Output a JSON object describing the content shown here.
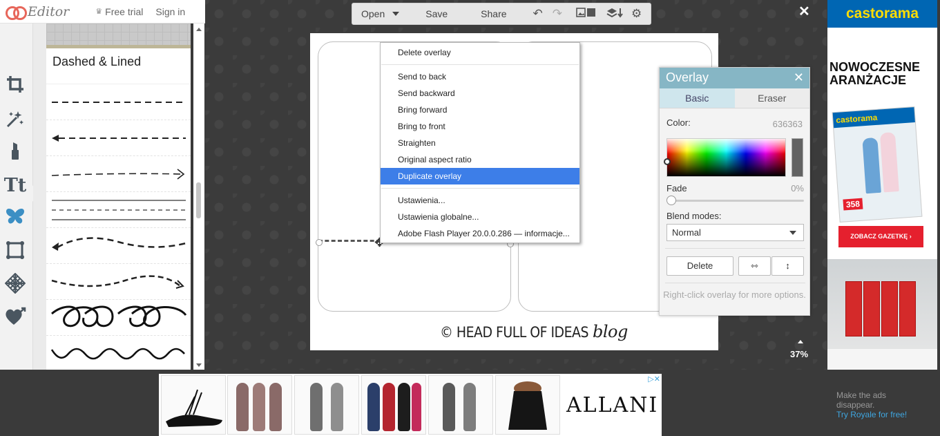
{
  "header": {
    "app_name": "Editor",
    "free_trial": "Free trial",
    "sign_in": "Sign in"
  },
  "tools": [
    {
      "name": "crop-icon",
      "glyph": "⌗"
    },
    {
      "name": "effects-wand-icon",
      "glyph": "✶"
    },
    {
      "name": "touch-up-lipstick-icon",
      "glyph": "▮"
    },
    {
      "name": "text-icon",
      "glyph": "Tt"
    },
    {
      "name": "overlays-butterfly-icon",
      "glyph": "❦"
    },
    {
      "name": "frames-icon",
      "glyph": "▣"
    },
    {
      "name": "textures-icon",
      "glyph": "▦"
    },
    {
      "name": "themes-heart-icon",
      "glyph": "♥"
    }
  ],
  "panel": {
    "section_title": "Dashed & Lined"
  },
  "menubar": {
    "open": "Open",
    "save": "Save",
    "share": "Share"
  },
  "canvas": {
    "watermark_text": "© HEAD FULL OF IDEAS",
    "watermark_blog": "blog",
    "zoom": "37%"
  },
  "context_menu": {
    "groups": [
      [
        "Delete overlay"
      ],
      [
        "Send to back",
        "Send backward",
        "Bring forward",
        "Bring to front",
        "Straighten",
        "Original aspect ratio",
        "Duplicate overlay"
      ],
      [
        "Ustawienia...",
        "Ustawienia globalne...",
        "Adobe Flash Player 20.0.0.286 — informacje..."
      ]
    ],
    "highlighted": "Duplicate overlay"
  },
  "overlay_panel": {
    "title": "Overlay",
    "tabs": [
      "Basic",
      "Eraser"
    ],
    "active_tab": "Basic",
    "color_label": "Color:",
    "color_value": "636363",
    "fade_label": "Fade",
    "fade_value": "0%",
    "fade_fraction": 0,
    "blend_label": "Blend modes:",
    "blend_value": "Normal",
    "delete_label": "Delete",
    "hint": "Right-click overlay for more options."
  },
  "ads": {
    "right": {
      "brand": "castorama",
      "headline": "NOWOCZESNE ARANŻACJE",
      "mag_brand": "castorama",
      "mag_price": "358",
      "button": "ZOBACZ GAZETKĘ ›"
    },
    "bottom": {
      "brand": "ALLANI",
      "choices": "▷✕"
    },
    "royale": {
      "line1": "Make the ads",
      "line2": "disappear.",
      "link": "Try Royale for free!"
    }
  },
  "colors": {
    "overlay_header": "#86b6c5",
    "context_highlight": "#3d7ee8",
    "castorama_blue": "#0066b3",
    "castorama_yellow": "#ffdd00",
    "ad_red": "#e5202e"
  }
}
